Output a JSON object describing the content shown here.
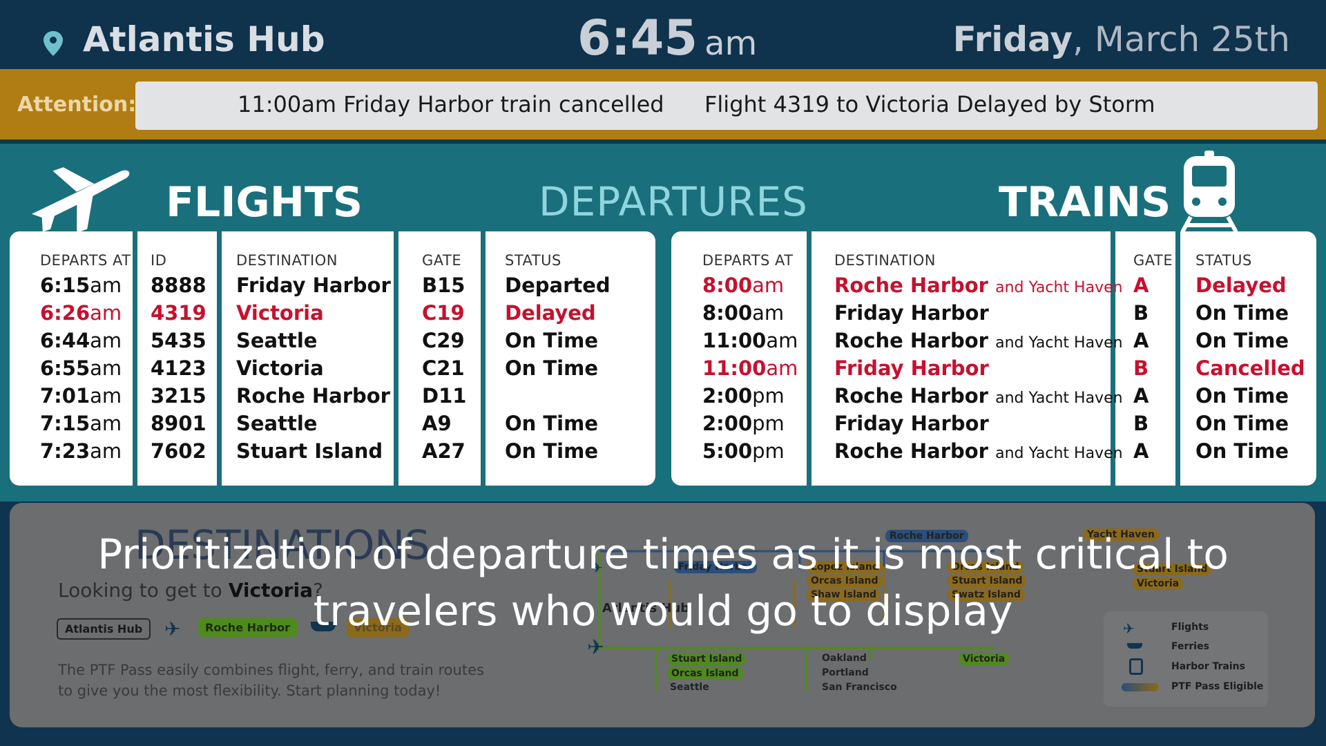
{
  "header": {
    "location": "Atlantis Hub",
    "time": "6:45",
    "ampm": "am",
    "day": "Friday",
    "date": ", March 25th"
  },
  "attention": {
    "label": "Attention:",
    "messages": [
      "11:00am Friday Harbor train cancelled",
      "Flight 4319 to Victoria Delayed by Storm"
    ]
  },
  "titles": {
    "flights": "FLIGHTS",
    "departures": "DEPARTURES",
    "trains": "TRAINS"
  },
  "flights": {
    "headers": {
      "departs": "DEPARTS AT",
      "id": "ID",
      "destination": "DESTINATION",
      "gate": "GATE",
      "status": "STATUS"
    },
    "rows": [
      {
        "time": "6:15",
        "ap": "am",
        "id": "8888",
        "dest": "Friday Harbor",
        "gate": "B15",
        "status": "Departed"
      },
      {
        "time": "6:26",
        "ap": "am",
        "id": "4319",
        "dest": "Victoria",
        "gate": "C19",
        "status": "Delayed"
      },
      {
        "time": "6:44",
        "ap": "am",
        "id": "5435",
        "dest": "Seattle",
        "gate": "C29",
        "status": "On Time"
      },
      {
        "time": "6:55",
        "ap": "am",
        "id": "4123",
        "dest": "Victoria",
        "gate": "C21",
        "status": "On Time"
      },
      {
        "time": "7:01",
        "ap": "am",
        "id": "3215",
        "dest": "Roche Harbor",
        "gate": "D11",
        "status": ""
      },
      {
        "time": "7:15",
        "ap": "am",
        "id": "8901",
        "dest": "Seattle",
        "gate": "A9",
        "status": "On Time"
      },
      {
        "time": "7:23",
        "ap": "am",
        "id": "7602",
        "dest": "Stuart Island",
        "gate": "A27",
        "status": "On Time"
      }
    ]
  },
  "trains": {
    "headers": {
      "departs": "DEPARTS AT",
      "destination": "DESTINATION",
      "gate": "GATE",
      "status": "STATUS"
    },
    "rows": [
      {
        "time": "8:00",
        "ap": "am",
        "dest": "Roche Harbor",
        "extra": "and Yacht Haven",
        "gate": "A",
        "status": "Delayed"
      },
      {
        "time": "8:00",
        "ap": "am",
        "dest": "Friday Harbor",
        "extra": "",
        "gate": "B",
        "status": "On Time"
      },
      {
        "time": "11:00",
        "ap": "am",
        "dest": "Roche Harbor",
        "extra": "and Yacht Haven",
        "gate": "A",
        "status": "On Time"
      },
      {
        "time": "11:00",
        "ap": "am",
        "dest": "Friday Harbor",
        "extra": "",
        "gate": "B",
        "status": "Cancelled"
      },
      {
        "time": "2:00",
        "ap": "pm",
        "dest": "Roche Harbor",
        "extra": "and Yacht Haven",
        "gate": "A",
        "status": "On Time"
      },
      {
        "time": "2:00",
        "ap": "pm",
        "dest": "Friday Harbor",
        "extra": "",
        "gate": "B",
        "status": "On Time"
      },
      {
        "time": "5:00",
        "ap": "pm",
        "dest": "Roche Harbor",
        "extra": "and Yacht Haven",
        "gate": "A",
        "status": "On Time"
      }
    ]
  },
  "destinations": {
    "title": "DESTINATIONS",
    "looking_prefix": "Looking to get to ",
    "looking_target": "Victoria",
    "looking_suffix": "?",
    "route": [
      "Atlantis Hub",
      "Roche Harbor",
      "Victoria"
    ],
    "blurb": "The PTF Pass easily combines flight, ferry, and train routes to give you the most flexibility. Start planning today!",
    "map_labels": [
      "Roche Harbor",
      "Yacht Haven",
      "Friday Harbor",
      "Lopez Island",
      "Orcas Island",
      "Shaw Island",
      "Orcas Island",
      "Stuart Island",
      "Swatz Island",
      "Stuart Island",
      "Victoria",
      "Stuart Island",
      "Orcas Island",
      "Seattle",
      "Oakland",
      "Portland",
      "San Francisco",
      "Victoria",
      "Atlantis Hub"
    ],
    "legend": [
      "Flights",
      "Ferries",
      "Harbor Trains",
      "PTF Pass Eligible"
    ]
  },
  "caption": "Prioritization of departure times as it is most critical to travelers who would go to display",
  "colors": {
    "alert_red": "#c8102e",
    "teal": "#1a6f7c",
    "attention_bar": "#b07d14",
    "header_bg": "#0f324d"
  }
}
